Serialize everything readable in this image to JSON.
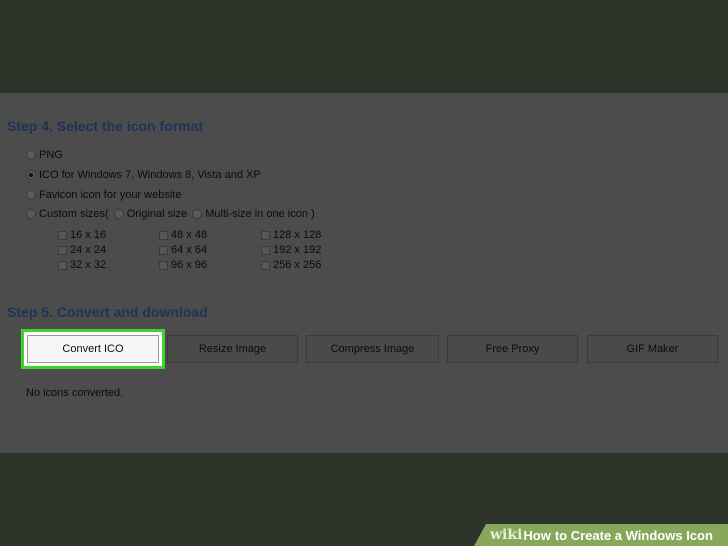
{
  "step4": {
    "title": "Step 4. Select the icon format",
    "options": [
      {
        "label": "PNG",
        "checked": false
      },
      {
        "label": "ICO for Windows 7, Windows 8, Vista and XP",
        "checked": true
      },
      {
        "label": "Favicon icon for your website",
        "checked": false
      },
      {
        "label": "Custom sizes(",
        "checked": false
      }
    ],
    "custom_suboptions": [
      {
        "label": "Original size",
        "checked": false
      },
      {
        "label": "Multi-size in one icon )",
        "checked": false
      }
    ],
    "sizes": [
      "16 x 16",
      "48 x 48",
      "128 x 128",
      "24 x 24",
      "64 x 64",
      "192 x 192",
      "32 x 32",
      "96 x 96",
      "256 x 256"
    ]
  },
  "step5": {
    "title": "Step 5. Convert and download",
    "buttons": [
      "Convert ICO",
      "Resize Image",
      "Compress Image",
      "Free Proxy",
      "GIF Maker"
    ],
    "status": "No icons converted."
  },
  "banner": {
    "wiki": "wiki",
    "how": "How",
    "rest": "to Create a Windows Icon"
  },
  "colors": {
    "highlight": "#3cd42a",
    "step_title": "#1e3357"
  }
}
